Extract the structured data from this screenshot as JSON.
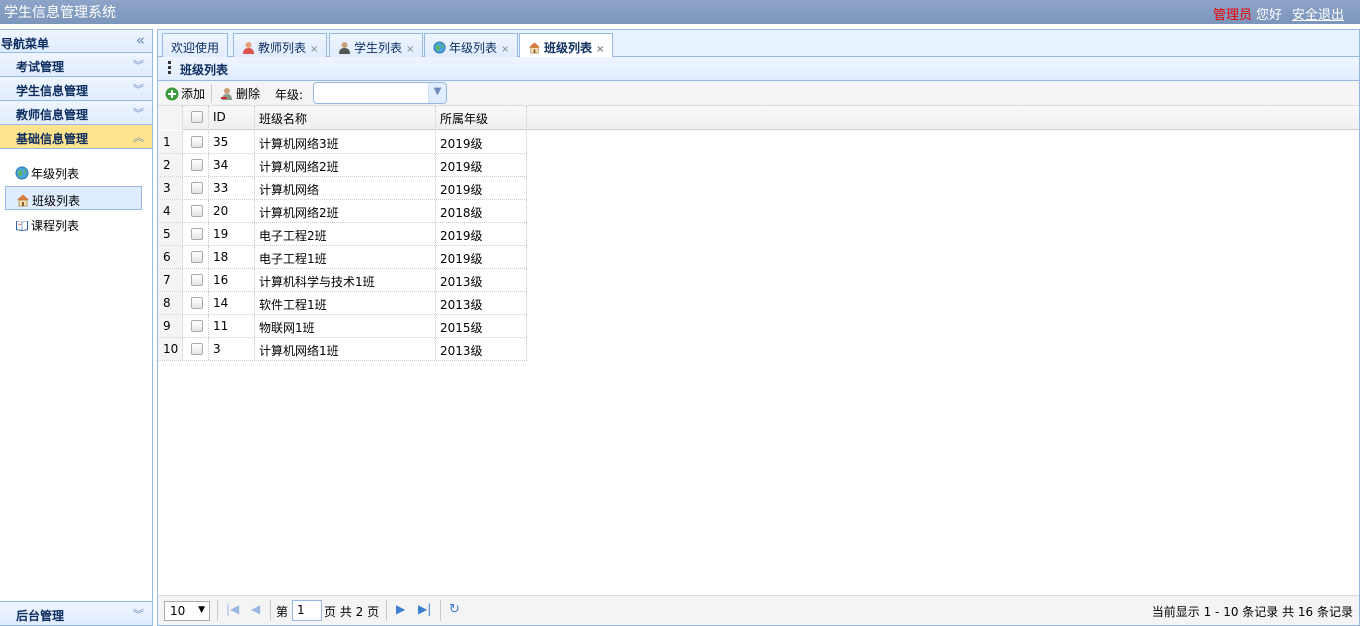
{
  "header": {
    "app_title": "学生信息管理系统",
    "admin_label": "管理员",
    "greeting": "您好",
    "logout_label": "安全退出"
  },
  "nav": {
    "title": "导航菜单",
    "sections": [
      {
        "label": "考试管理"
      },
      {
        "label": "学生信息管理"
      },
      {
        "label": "教师信息管理"
      },
      {
        "label": "基础信息管理"
      }
    ],
    "items": [
      {
        "label": "年级列表",
        "icon": "globe-icon"
      },
      {
        "label": "班级列表",
        "icon": "house-icon"
      },
      {
        "label": "课程列表",
        "icon": "book-icon"
      }
    ],
    "bottom_section": "后台管理"
  },
  "tabs": [
    {
      "label": "欢迎使用"
    },
    {
      "label": "教师列表",
      "icon": "teacher-icon"
    },
    {
      "label": "学生列表",
      "icon": "student-icon"
    },
    {
      "label": "年级列表",
      "icon": "globe-icon"
    },
    {
      "label": "班级列表",
      "icon": "house-icon"
    }
  ],
  "panel": {
    "title": "班级列表"
  },
  "toolbar": {
    "add_label": "添加",
    "delete_label": "删除",
    "grade_label": "年级:",
    "grade_value": ""
  },
  "grid": {
    "columns": [
      "ID",
      "班级名称",
      "所属年级"
    ],
    "rows": [
      {
        "n": "1",
        "id": "35",
        "name": "计算机网络3班",
        "grade": "2019级"
      },
      {
        "n": "2",
        "id": "34",
        "name": "计算机网络2班",
        "grade": "2019级"
      },
      {
        "n": "3",
        "id": "33",
        "name": "计算机网络",
        "grade": "2019级"
      },
      {
        "n": "4",
        "id": "20",
        "name": "计算机网络2班",
        "grade": "2018级"
      },
      {
        "n": "5",
        "id": "19",
        "name": "电子工程2班",
        "grade": "2019级"
      },
      {
        "n": "6",
        "id": "18",
        "name": "电子工程1班",
        "grade": "2019级"
      },
      {
        "n": "7",
        "id": "16",
        "name": "计算机科学与技术1班",
        "grade": "2013级"
      },
      {
        "n": "8",
        "id": "14",
        "name": "软件工程1班",
        "grade": "2013级"
      },
      {
        "n": "9",
        "id": "11",
        "name": "物联网1班",
        "grade": "2015级"
      },
      {
        "n": "10",
        "id": "3",
        "name": "计算机网络1班",
        "grade": "2013级"
      }
    ]
  },
  "pager": {
    "page_size": "10",
    "page_prefix": "第",
    "page_value": "1",
    "page_suffix": "页 共 2 页",
    "info": "当前显示 1 - 10 条记录 共 16 条记录"
  }
}
